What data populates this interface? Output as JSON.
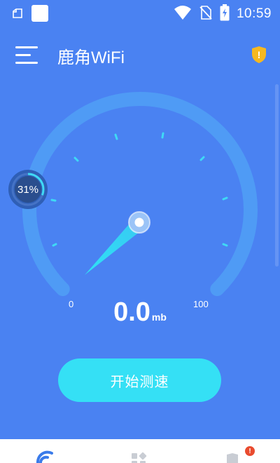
{
  "status_bar": {
    "time": "10:59",
    "icons": [
      "files-icon",
      "notification-square-icon",
      "wifi-icon",
      "no-sim-icon",
      "battery-charging-icon"
    ]
  },
  "header": {
    "title": "鹿角WiFi",
    "menu_icon": "hamburger-menu-icon",
    "action_icon": "shield-warning-icon",
    "action_badge": "!"
  },
  "progress": {
    "label": "31%",
    "value": 0.31
  },
  "gauge": {
    "min_label": "0",
    "max_label": "100",
    "speed_value": "0.0",
    "speed_unit": "mb"
  },
  "start_button": {
    "label": "开始测速"
  },
  "bottom_nav": {
    "items": [
      "wifi-tab-icon",
      "apps-tab-icon",
      "security-tab-icon"
    ],
    "badge": "!"
  },
  "colors": {
    "background": "#4A82F2",
    "accent": "#35E0F5",
    "badge": "#E94B2F",
    "shield": "#F5B820"
  }
}
